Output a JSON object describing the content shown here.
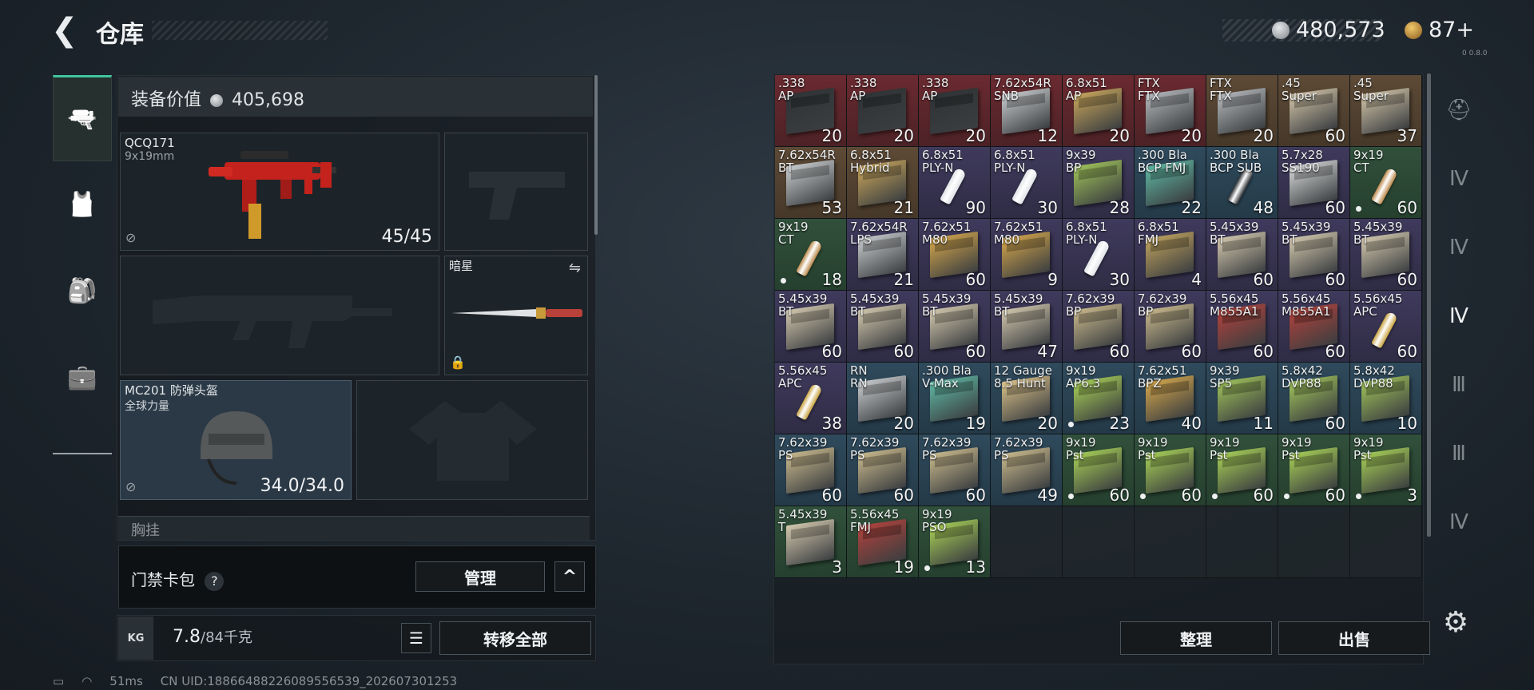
{
  "header": {
    "back_glyph": "❮",
    "title": "仓库",
    "currency1": "480,573",
    "currency2": "87+",
    "version": "0 0.8.0"
  },
  "left_nav": [
    {
      "icon": "pistol-icon",
      "glyph": "🔫"
    },
    {
      "icon": "armor-icon",
      "glyph": "🎽"
    },
    {
      "icon": "backpack-icon",
      "glyph": "🎒"
    },
    {
      "icon": "briefcase-icon",
      "glyph": "💼"
    }
  ],
  "equipment": {
    "value_label": "装备价值",
    "value": "405,698",
    "primary": {
      "name": "QCQ171",
      "caliber": "9x19mm",
      "durability": "45/45"
    },
    "melee": {
      "name": "暗星"
    },
    "helmet": {
      "name": "MC201 防弹头盔",
      "sub": "全球力量",
      "durability": "34.0/34.0"
    },
    "chest_label": "胸挂"
  },
  "keycard": {
    "label": "门禁卡包",
    "help": "?",
    "manage": "管理",
    "collapse": "^"
  },
  "weight": {
    "kg_label": "KG",
    "current": "7.8",
    "max": "/84千克",
    "transfer_all": "转移全部"
  },
  "status": {
    "ping": "51ms",
    "uid": "CN UID:18866488226089556539_202607301253"
  },
  "inventory": {
    "sort": "整理",
    "sell": "出售",
    "items": [
      {
        "name": ".338\nAP",
        "count": "20",
        "color": "red",
        "kind": "box",
        "tint": "#2f3336"
      },
      {
        "name": ".338\nAP",
        "count": "20",
        "color": "red",
        "kind": "box",
        "tint": "#2f3336"
      },
      {
        "name": ".338\nAP",
        "count": "20",
        "color": "red",
        "kind": "box",
        "tint": "#2f3336"
      },
      {
        "name": "7.62x54R\nSNB",
        "count": "12",
        "color": "red",
        "kind": "box",
        "tint": "#c9ccce"
      },
      {
        "name": "6.8x51\nAP",
        "count": "20",
        "color": "red",
        "kind": "box",
        "tint": "#c8a55c"
      },
      {
        "name": "FTX\nFTX",
        "count": "20",
        "color": "red",
        "kind": "box",
        "tint": "#b5b8bc"
      },
      {
        "name": "FTX\nFTX",
        "count": "20",
        "color": "brown",
        "kind": "box",
        "tint": "#b5b8bc"
      },
      {
        "name": ".45\nSuper",
        "count": "60",
        "color": "brown",
        "kind": "box",
        "tint": "#d2c4a8"
      },
      {
        "name": ".45\nSuper",
        "count": "37",
        "color": "brown",
        "kind": "box",
        "tint": "#d2c4a8"
      },
      {
        "name": "7.62x54R\nBT",
        "count": "53",
        "color": "brown",
        "kind": "box",
        "tint": "#c9ccce"
      },
      {
        "name": "6.8x51\nHybrid",
        "count": "21",
        "color": "brown",
        "kind": "box",
        "tint": "#c8a55c"
      },
      {
        "name": "6.8x51\nPLY-N",
        "count": "90",
        "color": "purple",
        "kind": "bullet",
        "tint": "#dfe3e6"
      },
      {
        "name": "6.8x51\nPLY-N",
        "count": "30",
        "color": "purple",
        "kind": "bullet",
        "tint": "#dfe3e6"
      },
      {
        "name": "9x39\nBP",
        "count": "28",
        "color": "purple",
        "kind": "box",
        "tint": "#9fc25a"
      },
      {
        "name": ".300 Bla\nBCP FMJ",
        "count": "22",
        "color": "blue",
        "kind": "box",
        "tint": "#5fb7a3"
      },
      {
        "name": ".300 Bla\nBCP SUB",
        "count": "48",
        "color": "blue",
        "kind": "bullet",
        "tint": "#2b2f33"
      },
      {
        "name": "5.7x28\nSS190",
        "count": "60",
        "color": "purple",
        "kind": "box",
        "tint": "#d6d8d9"
      },
      {
        "name": "9x19\nCT",
        "count": "60",
        "color": "green",
        "kind": "bullet",
        "tint": "#b98546",
        "dot": true
      },
      {
        "name": "9x19\nCT",
        "count": "18",
        "color": "green",
        "kind": "bullet",
        "tint": "#b98546",
        "dot": true
      },
      {
        "name": "7.62x54R\nLPS",
        "count": "21",
        "color": "purple",
        "kind": "box",
        "tint": "#c9ccce"
      },
      {
        "name": "7.62x51\nM80",
        "count": "60",
        "color": "purple",
        "kind": "box",
        "tint": "#d4a64c"
      },
      {
        "name": "7.62x51\nM80",
        "count": "9",
        "color": "purple",
        "kind": "box",
        "tint": "#d4a64c"
      },
      {
        "name": "6.8x51\nPLY-N",
        "count": "30",
        "color": "purple",
        "kind": "bullet",
        "tint": "#dfe3e6"
      },
      {
        "name": "6.8x51\nFMJ",
        "count": "4",
        "color": "purple",
        "kind": "box",
        "tint": "#c0a35e"
      },
      {
        "name": "5.45x39\nBT",
        "count": "60",
        "color": "purple",
        "kind": "box",
        "tint": "#d2c7ad"
      },
      {
        "name": "5.45x39\nBT",
        "count": "60",
        "color": "purple",
        "kind": "box",
        "tint": "#d2c7ad"
      },
      {
        "name": "5.45x39\nBT",
        "count": "60",
        "color": "purple",
        "kind": "box",
        "tint": "#d2c7ad"
      },
      {
        "name": "5.45x39\nBT",
        "count": "60",
        "color": "purple",
        "kind": "box",
        "tint": "#d2c7ad"
      },
      {
        "name": "5.45x39\nBT",
        "count": "60",
        "color": "purple",
        "kind": "box",
        "tint": "#d2c7ad"
      },
      {
        "name": "5.45x39\nBT",
        "count": "60",
        "color": "purple",
        "kind": "box",
        "tint": "#d2c7ad"
      },
      {
        "name": "5.45x39\nBT",
        "count": "47",
        "color": "purple",
        "kind": "box",
        "tint": "#d2c7ad"
      },
      {
        "name": "7.62x39\nBP",
        "count": "60",
        "color": "purple",
        "kind": "box",
        "tint": "#c9b88c"
      },
      {
        "name": "7.62x39\nBP",
        "count": "60",
        "color": "purple",
        "kind": "box",
        "tint": "#c9b88c"
      },
      {
        "name": "5.56x45\nM855A1",
        "count": "60",
        "color": "purple",
        "kind": "box",
        "tint": "#b2423c"
      },
      {
        "name": "5.56x45\nM855A1",
        "count": "60",
        "color": "purple",
        "kind": "box",
        "tint": "#b2423c"
      },
      {
        "name": "5.56x45\nAPC",
        "count": "60",
        "color": "purple",
        "kind": "bullet",
        "tint": "#c9a23e"
      },
      {
        "name": "5.56x45\nAPC",
        "count": "38",
        "color": "purple",
        "kind": "bullet",
        "tint": "#c9a23e"
      },
      {
        "name": "RN\nRN",
        "count": "20",
        "color": "blue",
        "kind": "box",
        "tint": "#c9ccce"
      },
      {
        "name": ".300 Bla\nV-Max",
        "count": "19",
        "color": "blue",
        "kind": "box",
        "tint": "#5fb7a3"
      },
      {
        "name": "12 Gauge\n8.5 Hunt",
        "count": "20",
        "color": "blue",
        "kind": "box",
        "tint": "#d9c089"
      },
      {
        "name": "9x19\nAP6.3",
        "count": "23",
        "color": "blue",
        "kind": "box",
        "tint": "#a7cf56",
        "dot": true
      },
      {
        "name": "7.62x51\nBPZ",
        "count": "40",
        "color": "blue",
        "kind": "box",
        "tint": "#d4a64c"
      },
      {
        "name": "9x39\nSP5",
        "count": "11",
        "color": "blue",
        "kind": "box",
        "tint": "#9fc25a"
      },
      {
        "name": "5.8x42\nDVP88",
        "count": "60",
        "color": "blue",
        "kind": "box",
        "tint": "#9fc25a"
      },
      {
        "name": "5.8x42\nDVP88",
        "count": "10",
        "color": "blue",
        "kind": "box",
        "tint": "#9fc25a"
      },
      {
        "name": "7.62x39\nPS",
        "count": "60",
        "color": "blue",
        "kind": "box",
        "tint": "#c9b88c"
      },
      {
        "name": "7.62x39\nPS",
        "count": "60",
        "color": "blue",
        "kind": "box",
        "tint": "#c9b88c"
      },
      {
        "name": "7.62x39\nPS",
        "count": "60",
        "color": "blue",
        "kind": "box",
        "tint": "#c9b88c"
      },
      {
        "name": "7.62x39\nPS",
        "count": "49",
        "color": "blue",
        "kind": "box",
        "tint": "#c9b88c"
      },
      {
        "name": "9x19\nPst",
        "count": "60",
        "color": "green",
        "kind": "box",
        "tint": "#a7cf56",
        "dot": true
      },
      {
        "name": "9x19\nPst",
        "count": "60",
        "color": "green",
        "kind": "box",
        "tint": "#a7cf56",
        "dot": true
      },
      {
        "name": "9x19\nPst",
        "count": "60",
        "color": "green",
        "kind": "box",
        "tint": "#a7cf56",
        "dot": true
      },
      {
        "name": "9x19\nPst",
        "count": "60",
        "color": "green",
        "kind": "box",
        "tint": "#a7cf56",
        "dot": true
      },
      {
        "name": "9x19\nPst",
        "count": "3",
        "color": "green",
        "kind": "box",
        "tint": "#a7cf56",
        "dot": true
      },
      {
        "name": "5.45x39\nT",
        "count": "3",
        "color": "green",
        "kind": "box",
        "tint": "#d2c7ad"
      },
      {
        "name": "5.56x45\nFMJ",
        "count": "19",
        "color": "green",
        "kind": "box",
        "tint": "#b2423c"
      },
      {
        "name": "9x19\nPSO",
        "count": "13",
        "color": "green",
        "kind": "box",
        "tint": "#a7cf56",
        "dot": true
      }
    ]
  },
  "right_nav": [
    {
      "icon": "helmet-icon",
      "glyph": "⛑",
      "active": false
    },
    {
      "icon": "armor-tier4-icon",
      "glyph": "Ⅳ",
      "active": false
    },
    {
      "icon": "armor-tier4b-icon",
      "glyph": "Ⅳ",
      "active": false
    },
    {
      "icon": "ammo-tier4-icon",
      "glyph": "Ⅳ",
      "active": true
    },
    {
      "icon": "armor-tier3-icon",
      "glyph": "Ⅲ",
      "active": false
    },
    {
      "icon": "rig-tier3-icon",
      "glyph": "Ⅲ",
      "active": false
    },
    {
      "icon": "armor-tier4c-icon",
      "glyph": "Ⅳ",
      "active": false
    }
  ],
  "colors": {
    "red": "#5b272c",
    "brown": "#4f3f2f",
    "purple": "#36324f",
    "blue": "#2a4252",
    "green": "#2b4634",
    "accent": "#3fc5a0"
  }
}
